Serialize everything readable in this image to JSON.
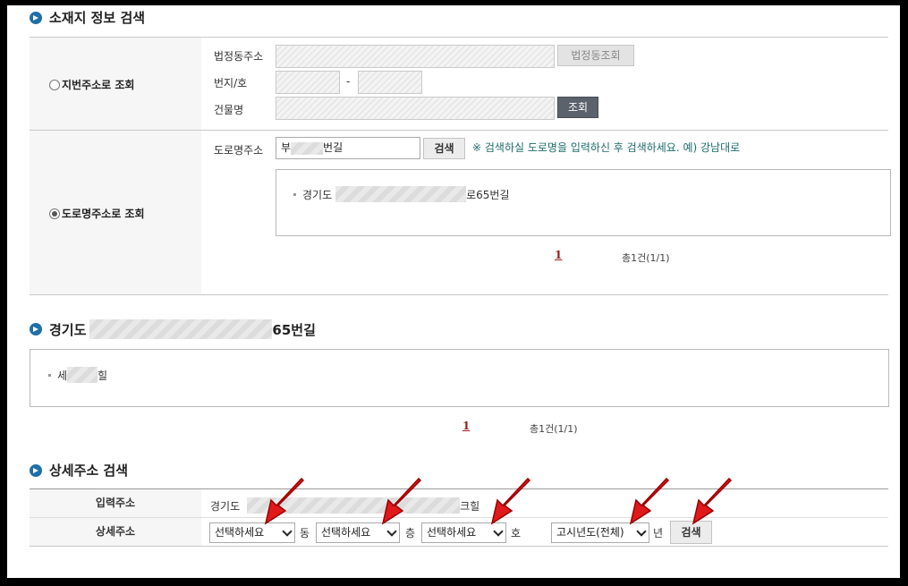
{
  "sections": {
    "location_search_title": "소재지 정보 검색",
    "result_title_prefix": "경기도",
    "result_title_suffix": "65번길",
    "detail_search_title": "상세주소 검색"
  },
  "jibun": {
    "radio_label": "지번주소로 조회",
    "beopjeong_label": "법정동주소",
    "beopjeong_button": "법정동조회",
    "bunji_label": "번지/호",
    "dash": "-",
    "building_label": "건물명",
    "search_button": "조회"
  },
  "road": {
    "radio_label": "도로명주소로 조회",
    "road_label": "도로명주소",
    "input_prefix": "부",
    "input_suffix": "번길",
    "search_button": "검색",
    "hint": "※ 검색하실 도로명을 입력하신 후 검색하세요. 예) 강남대로",
    "result_prefix": "경기도",
    "result_suffix": "로65번길",
    "page": "1",
    "total": "총1건(1/1)"
  },
  "building_results": {
    "item_prefix": "세",
    "item_suffix": "힐",
    "page": "1",
    "total": "총1건(1/1)"
  },
  "detail": {
    "input_label": "입력주소",
    "input_prefix": "경기도",
    "input_suffix": "크힐",
    "detail_label": "상세주소",
    "select_dong": "선택하세요",
    "unit_dong": "동",
    "select_floor": "선택하세요",
    "unit_floor": "층",
    "select_ho": "선택하세요",
    "unit_ho": "호",
    "select_year": "고시년도(전체)",
    "unit_year": "년",
    "search_button": "검색"
  },
  "colors": {
    "accent_blue": "#1f6fa8",
    "link_red": "#9b1c1c",
    "hint_teal": "#1d6b6b",
    "arrow_red": "#e0191b"
  }
}
